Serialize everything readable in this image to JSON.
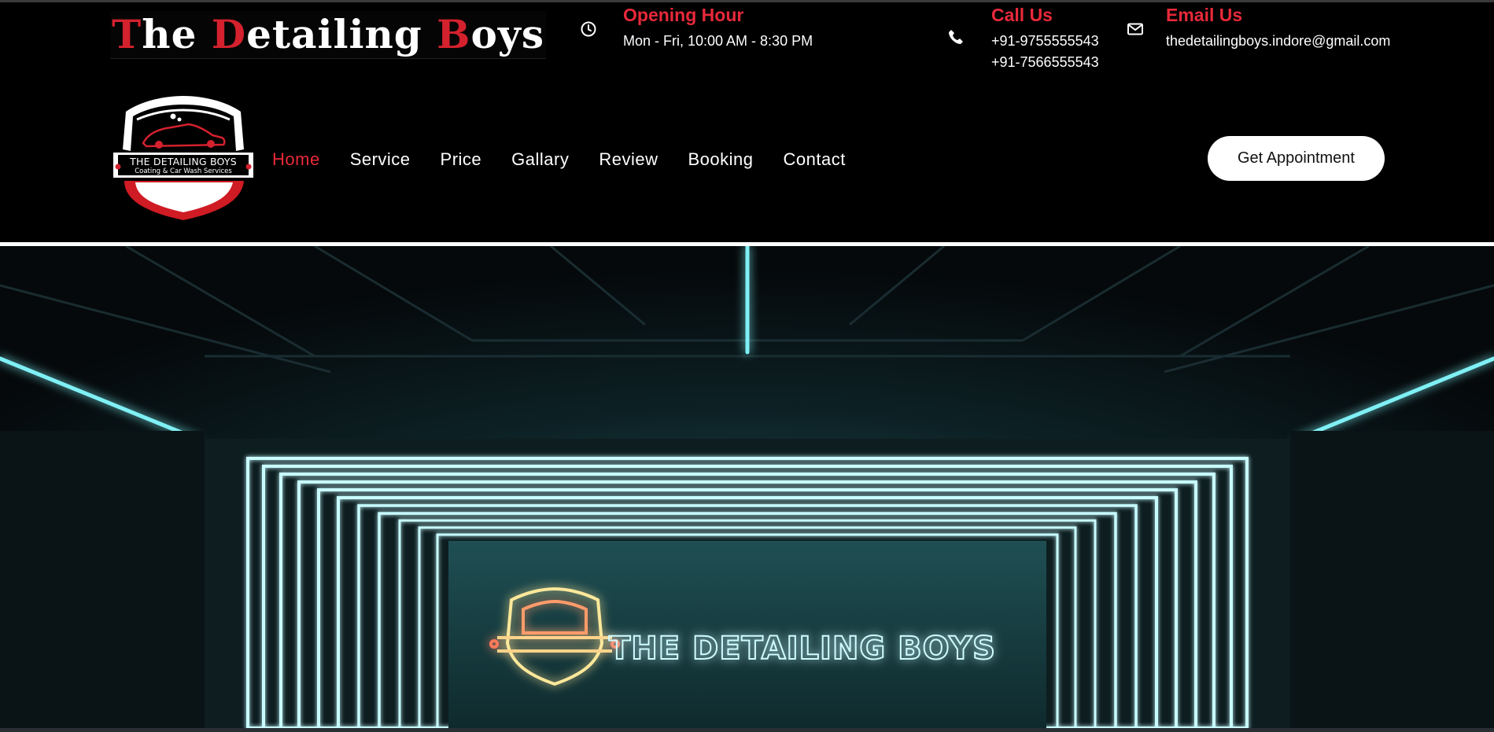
{
  "brand": {
    "title_parts": [
      {
        "text": "T",
        "red": true
      },
      {
        "text": "he ",
        "red": false
      },
      {
        "text": "D",
        "red": true
      },
      {
        "text": "etailing ",
        "red": false
      },
      {
        "text": "B",
        "red": true
      },
      {
        "text": "oys",
        "red": false
      }
    ]
  },
  "info": {
    "hours": {
      "title": "Opening Hour",
      "line1": "Mon - Fri, 10:00 AM - 8:30 PM",
      "icon": "clock-icon"
    },
    "call": {
      "title": "Call Us",
      "line1": "+91-9755555543",
      "line2": "+91-7566555543",
      "icon": "phone-icon"
    },
    "email": {
      "title": "Email Us",
      "line1": "thedetailingboys.indore@gmail.com",
      "icon": "envelope-icon"
    }
  },
  "logo": {
    "line1": "THE DETAILING BOYS",
    "line2": "Coating & Car Wash Services"
  },
  "nav": {
    "items": [
      "Home",
      "Service",
      "Price",
      "Gallary",
      "Review",
      "Booking",
      "Contact"
    ],
    "active_index": 0
  },
  "cta": {
    "label": "Get Appointment"
  },
  "hero": {
    "sign_text": "THE DETAILING BOYS"
  },
  "colors": {
    "accent": "#e8293a",
    "background": "#000000",
    "neon": "#6fe6ee"
  }
}
